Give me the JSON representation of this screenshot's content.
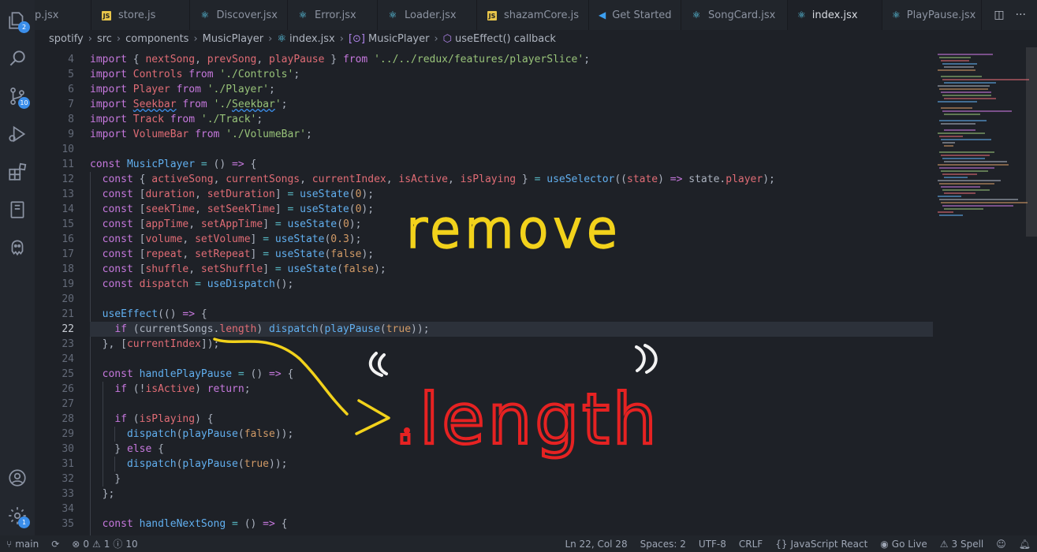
{
  "activity_bar": {
    "items": [
      {
        "icon": "explorer-icon",
        "badge": "2"
      },
      {
        "icon": "search-icon",
        "badge": ""
      },
      {
        "icon": "source-control-icon",
        "badge": "10"
      },
      {
        "icon": "run-debug-icon",
        "badge": ""
      },
      {
        "icon": "extensions-icon",
        "badge": ""
      },
      {
        "icon": "notebook-icon",
        "badge": ""
      },
      {
        "icon": "github-icon",
        "badge": ""
      }
    ],
    "account_icon": "account-icon",
    "settings_badge": "1"
  },
  "tabs": [
    {
      "label": "p.jsx",
      "icon": "react"
    },
    {
      "label": "store.js",
      "icon": "js"
    },
    {
      "label": "Discover.jsx",
      "icon": "react"
    },
    {
      "label": "Error.jsx",
      "icon": "react"
    },
    {
      "label": "Loader.jsx",
      "icon": "react"
    },
    {
      "label": "shazamCore.js",
      "icon": "js"
    },
    {
      "label": "Get Started",
      "icon": "vscode"
    },
    {
      "label": "SongCard.jsx",
      "icon": "react"
    },
    {
      "label": "index.jsx",
      "icon": "react",
      "active": true,
      "dirty": true
    },
    {
      "label": "PlayPause.jsx",
      "icon": "react"
    }
  ],
  "breadcrumb": {
    "parts": [
      "spotify",
      "src",
      "components",
      "MusicPlayer",
      "index.jsx",
      "MusicPlayer",
      "useEffect() callback"
    ]
  },
  "editor": {
    "current_line": 22,
    "lines": [
      {
        "n": "4",
        "t": [
          [
            "kw",
            "import "
          ],
          [
            "pl",
            "{ "
          ],
          [
            "var",
            "nextSong"
          ],
          [
            "pl",
            ", "
          ],
          [
            "var",
            "prevSong"
          ],
          [
            "pl",
            ", "
          ],
          [
            "var",
            "playPause"
          ],
          [
            "pl",
            " } "
          ],
          [
            "kw",
            "from "
          ],
          [
            "str",
            "'../../redux/features/playerSlice'"
          ],
          [
            "pl",
            ";"
          ]
        ]
      },
      {
        "n": "5",
        "t": [
          [
            "kw",
            "import "
          ],
          [
            "var",
            "Controls"
          ],
          [
            "kw",
            " from "
          ],
          [
            "str",
            "'./Controls'"
          ],
          [
            "pl",
            ";"
          ]
        ]
      },
      {
        "n": "6",
        "t": [
          [
            "kw",
            "import "
          ],
          [
            "var",
            "Player"
          ],
          [
            "kw",
            " from "
          ],
          [
            "str",
            "'./Player'"
          ],
          [
            "pl",
            ";"
          ]
        ]
      },
      {
        "n": "7",
        "t": [
          [
            "kw",
            "import "
          ],
          [
            "var squig",
            "Seekbar"
          ],
          [
            "kw",
            " from "
          ],
          [
            "str",
            "'./"
          ],
          [
            "str squig",
            "Seekbar"
          ],
          [
            "str",
            "'"
          ],
          [
            "pl",
            ";"
          ]
        ]
      },
      {
        "n": "8",
        "t": [
          [
            "kw",
            "import "
          ],
          [
            "var",
            "Track"
          ],
          [
            "kw",
            " from "
          ],
          [
            "str",
            "'./Track'"
          ],
          [
            "pl",
            ";"
          ]
        ]
      },
      {
        "n": "9",
        "t": [
          [
            "kw",
            "import "
          ],
          [
            "var",
            "VolumeBar"
          ],
          [
            "kw",
            " from "
          ],
          [
            "str",
            "'./VolumeBar'"
          ],
          [
            "pl",
            ";"
          ]
        ]
      },
      {
        "n": "10",
        "t": []
      },
      {
        "n": "11",
        "t": [
          [
            "kw",
            "const "
          ],
          [
            "fn",
            "MusicPlayer"
          ],
          [
            "op",
            " = "
          ],
          [
            "pl",
            "() "
          ],
          [
            "kw",
            "=>"
          ],
          [
            "pl",
            " {"
          ]
        ]
      },
      {
        "n": "12",
        "t": [
          [
            "pl",
            "  "
          ],
          [
            "kw",
            "const "
          ],
          [
            "pl",
            "{ "
          ],
          [
            "var",
            "activeSong"
          ],
          [
            "pl",
            ", "
          ],
          [
            "var",
            "currentSongs"
          ],
          [
            "pl",
            ", "
          ],
          [
            "var",
            "currentIndex"
          ],
          [
            "pl",
            ", "
          ],
          [
            "var",
            "isActive"
          ],
          [
            "pl",
            ", "
          ],
          [
            "var",
            "isPlaying"
          ],
          [
            "pl",
            " } "
          ],
          [
            "op",
            "= "
          ],
          [
            "fn",
            "useSelector"
          ],
          [
            "pl",
            "(("
          ],
          [
            "var",
            "state"
          ],
          [
            "pl",
            ") "
          ],
          [
            "kw",
            "=> "
          ],
          [
            "pl",
            "state."
          ],
          [
            "var",
            "player"
          ],
          [
            "pl",
            ");"
          ]
        ]
      },
      {
        "n": "13",
        "t": [
          [
            "pl",
            "  "
          ],
          [
            "kw",
            "const "
          ],
          [
            "pl",
            "["
          ],
          [
            "var",
            "duration"
          ],
          [
            "pl",
            ", "
          ],
          [
            "var",
            "setDuration"
          ],
          [
            "pl",
            "] "
          ],
          [
            "op",
            "= "
          ],
          [
            "fn",
            "useState"
          ],
          [
            "pl",
            "("
          ],
          [
            "num",
            "0"
          ],
          [
            "pl",
            ");"
          ]
        ]
      },
      {
        "n": "14",
        "t": [
          [
            "pl",
            "  "
          ],
          [
            "kw",
            "const "
          ],
          [
            "pl",
            "["
          ],
          [
            "var",
            "seekTime"
          ],
          [
            "pl",
            ", "
          ],
          [
            "var",
            "setSeekTime"
          ],
          [
            "pl",
            "] "
          ],
          [
            "op",
            "= "
          ],
          [
            "fn",
            "useState"
          ],
          [
            "pl",
            "("
          ],
          [
            "num",
            "0"
          ],
          [
            "pl",
            ");"
          ]
        ]
      },
      {
        "n": "15",
        "t": [
          [
            "pl",
            "  "
          ],
          [
            "kw",
            "const "
          ],
          [
            "pl",
            "["
          ],
          [
            "var",
            "appTime"
          ],
          [
            "pl",
            ", "
          ],
          [
            "var",
            "setAppTime"
          ],
          [
            "pl",
            "] "
          ],
          [
            "op",
            "= "
          ],
          [
            "fn",
            "useState"
          ],
          [
            "pl",
            "("
          ],
          [
            "num",
            "0"
          ],
          [
            "pl",
            ");"
          ]
        ]
      },
      {
        "n": "16",
        "t": [
          [
            "pl",
            "  "
          ],
          [
            "kw",
            "const "
          ],
          [
            "pl",
            "["
          ],
          [
            "var",
            "volume"
          ],
          [
            "pl",
            ", "
          ],
          [
            "var",
            "setVolume"
          ],
          [
            "pl",
            "] "
          ],
          [
            "op",
            "= "
          ],
          [
            "fn",
            "useState"
          ],
          [
            "pl",
            "("
          ],
          [
            "num",
            "0.3"
          ],
          [
            "pl",
            ");"
          ]
        ]
      },
      {
        "n": "17",
        "t": [
          [
            "pl",
            "  "
          ],
          [
            "kw",
            "const "
          ],
          [
            "pl",
            "["
          ],
          [
            "var",
            "repeat"
          ],
          [
            "pl",
            ", "
          ],
          [
            "var",
            "setRepeat"
          ],
          [
            "pl",
            "] "
          ],
          [
            "op",
            "= "
          ],
          [
            "fn",
            "useState"
          ],
          [
            "pl",
            "("
          ],
          [
            "num",
            "false"
          ],
          [
            "pl",
            ");"
          ]
        ]
      },
      {
        "n": "18",
        "t": [
          [
            "pl",
            "  "
          ],
          [
            "kw",
            "const "
          ],
          [
            "pl",
            "["
          ],
          [
            "var",
            "shuffle"
          ],
          [
            "pl",
            ", "
          ],
          [
            "var",
            "setShuffle"
          ],
          [
            "pl",
            "] "
          ],
          [
            "op",
            "= "
          ],
          [
            "fn",
            "useState"
          ],
          [
            "pl",
            "("
          ],
          [
            "num",
            "false"
          ],
          [
            "pl",
            ");"
          ]
        ]
      },
      {
        "n": "19",
        "t": [
          [
            "pl",
            "  "
          ],
          [
            "kw",
            "const "
          ],
          [
            "var",
            "dispatch"
          ],
          [
            "op",
            " = "
          ],
          [
            "fn",
            "useDispatch"
          ],
          [
            "pl",
            "();"
          ]
        ]
      },
      {
        "n": "20",
        "t": []
      },
      {
        "n": "21",
        "t": [
          [
            "pl",
            "  "
          ],
          [
            "fn",
            "useEffect"
          ],
          [
            "pl",
            "(() "
          ],
          [
            "kw",
            "=>"
          ],
          [
            "pl",
            " {"
          ]
        ]
      },
      {
        "n": "22",
        "t": [
          [
            "pl",
            "    "
          ],
          [
            "kw",
            "if "
          ],
          [
            "pl",
            "(currentSongs."
          ],
          [
            "var",
            "length"
          ],
          [
            "pl",
            ") "
          ],
          [
            "fn",
            "dispatch"
          ],
          [
            "pl",
            "("
          ],
          [
            "fn",
            "playPause"
          ],
          [
            "pl",
            "("
          ],
          [
            "num",
            "true"
          ],
          [
            "pl",
            "));"
          ]
        ]
      },
      {
        "n": "23",
        "t": [
          [
            "pl",
            "  }, ["
          ],
          [
            "var",
            "currentIndex"
          ],
          [
            "pl",
            "]);"
          ]
        ]
      },
      {
        "n": "24",
        "t": []
      },
      {
        "n": "25",
        "t": [
          [
            "pl",
            "  "
          ],
          [
            "kw",
            "const "
          ],
          [
            "fn",
            "handlePlayPause"
          ],
          [
            "op",
            " = "
          ],
          [
            "pl",
            "() "
          ],
          [
            "kw",
            "=>"
          ],
          [
            "pl",
            " {"
          ]
        ]
      },
      {
        "n": "26",
        "t": [
          [
            "pl",
            "    "
          ],
          [
            "kw",
            "if "
          ],
          [
            "pl",
            "(!"
          ],
          [
            "var",
            "isActive"
          ],
          [
            "pl",
            ") "
          ],
          [
            "kw",
            "return"
          ],
          [
            "pl",
            ";"
          ]
        ]
      },
      {
        "n": "27",
        "t": []
      },
      {
        "n": "28",
        "t": [
          [
            "pl",
            "    "
          ],
          [
            "kw",
            "if "
          ],
          [
            "pl",
            "("
          ],
          [
            "var",
            "isPlaying"
          ],
          [
            "pl",
            ") {"
          ]
        ]
      },
      {
        "n": "29",
        "t": [
          [
            "pl",
            "      "
          ],
          [
            "fn",
            "dispatch"
          ],
          [
            "pl",
            "("
          ],
          [
            "fn",
            "playPause"
          ],
          [
            "pl",
            "("
          ],
          [
            "num",
            "false"
          ],
          [
            "pl",
            "));"
          ]
        ]
      },
      {
        "n": "30",
        "t": [
          [
            "pl",
            "    } "
          ],
          [
            "kw",
            "else"
          ],
          [
            "pl",
            " {"
          ]
        ]
      },
      {
        "n": "31",
        "t": [
          [
            "pl",
            "      "
          ],
          [
            "fn",
            "dispatch"
          ],
          [
            "pl",
            "("
          ],
          [
            "fn",
            "playPause"
          ],
          [
            "pl",
            "("
          ],
          [
            "num",
            "true"
          ],
          [
            "pl",
            "));"
          ]
        ]
      },
      {
        "n": "32",
        "t": [
          [
            "pl",
            "    }"
          ]
        ]
      },
      {
        "n": "33",
        "t": [
          [
            "pl",
            "  };"
          ]
        ]
      },
      {
        "n": "34",
        "t": []
      },
      {
        "n": "35",
        "t": [
          [
            "pl",
            "  "
          ],
          [
            "kw",
            "const "
          ],
          [
            "fn",
            "handleNextSong"
          ],
          [
            "op",
            " = "
          ],
          [
            "pl",
            "() "
          ],
          [
            "kw",
            "=>"
          ],
          [
            "pl",
            " {"
          ]
        ]
      }
    ]
  },
  "annotations": {
    "remove_text": "remove",
    "length_text": ".length",
    "remove_color": "#f2d21b",
    "length_color": "#e62222"
  },
  "status_bar": {
    "branch": "main",
    "errors": "0",
    "warnings": "1",
    "info": "10",
    "position": "Ln 22, Col 28",
    "spaces": "Spaces: 2",
    "encoding": "UTF-8",
    "eol": "CRLF",
    "language": "JavaScript React",
    "go_live": "Go Live",
    "spell": "3 Spell"
  }
}
